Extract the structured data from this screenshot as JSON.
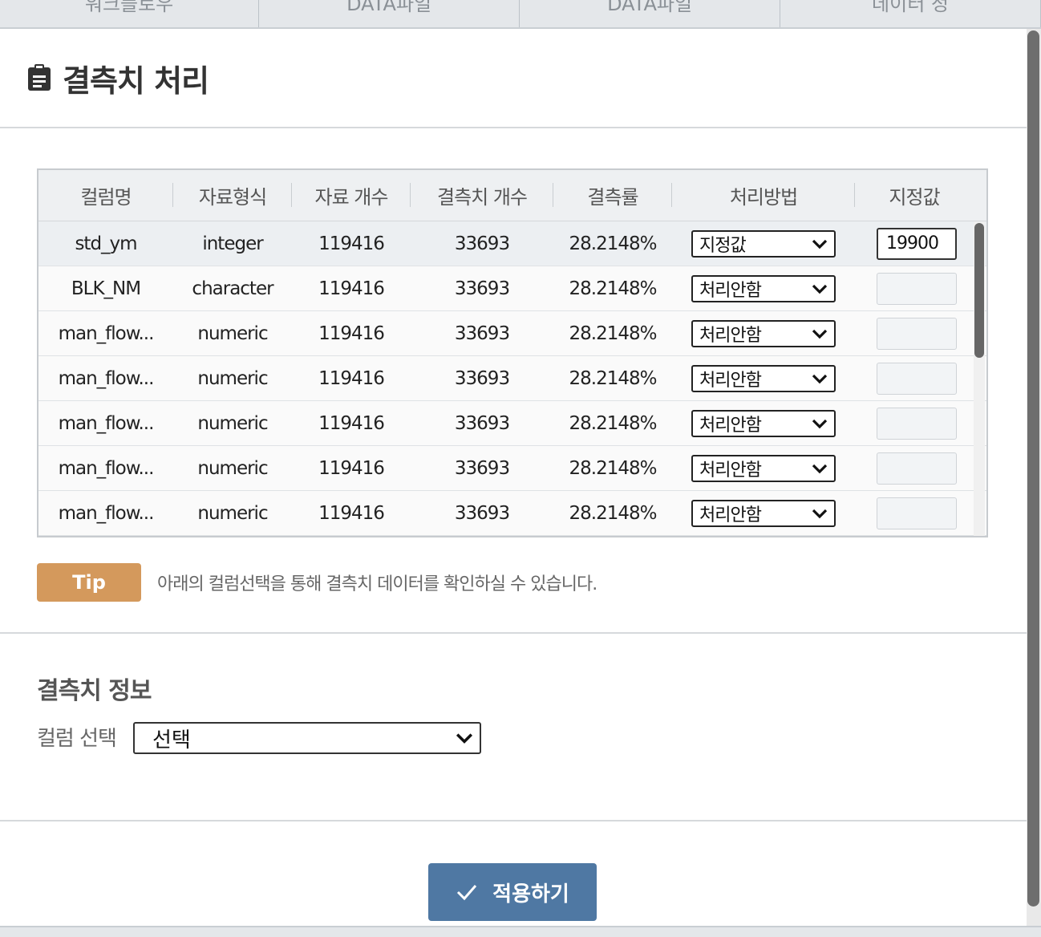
{
  "top_tabs": [
    "워크플로우",
    "DATA파일",
    "DATA파일",
    "데이터 정"
  ],
  "page_title": "결측치 처리",
  "table": {
    "headers": [
      "컬럼명",
      "자료형식",
      "자료 개수",
      "결측치 개수",
      "결측률",
      "처리방법",
      "지정값"
    ],
    "rows": [
      {
        "col": "std_ym",
        "type": "integer",
        "count": "119416",
        "missing": "33693",
        "rate": "28.2148%",
        "method": "지정값",
        "value": "19900"
      },
      {
        "col": "BLK_NM",
        "type": "character",
        "count": "119416",
        "missing": "33693",
        "rate": "28.2148%",
        "method": "처리안함",
        "value": ""
      },
      {
        "col": "man_flow...",
        "type": "numeric",
        "count": "119416",
        "missing": "33693",
        "rate": "28.2148%",
        "method": "처리안함",
        "value": ""
      },
      {
        "col": "man_flow...",
        "type": "numeric",
        "count": "119416",
        "missing": "33693",
        "rate": "28.2148%",
        "method": "처리안함",
        "value": ""
      },
      {
        "col": "man_flow...",
        "type": "numeric",
        "count": "119416",
        "missing": "33693",
        "rate": "28.2148%",
        "method": "처리안함",
        "value": ""
      },
      {
        "col": "man_flow...",
        "type": "numeric",
        "count": "119416",
        "missing": "33693",
        "rate": "28.2148%",
        "method": "처리안함",
        "value": ""
      },
      {
        "col": "man_flow...",
        "type": "numeric",
        "count": "119416",
        "missing": "33693",
        "rate": "28.2148%",
        "method": "처리안함",
        "value": ""
      }
    ]
  },
  "tip": {
    "badge": "Tip",
    "text": "아래의 컬럼선택을 통해 결측치 데이터를 확인하실 수 있습니다."
  },
  "missing_info": {
    "title": "결측치 정보",
    "column_label": "컬럼 선택",
    "column_select_value": "선택"
  },
  "apply_button": "적용하기",
  "colors": {
    "tip_badge": "#d4995c",
    "apply_button": "#4f78a3",
    "header_bg": "#eef0f2"
  }
}
